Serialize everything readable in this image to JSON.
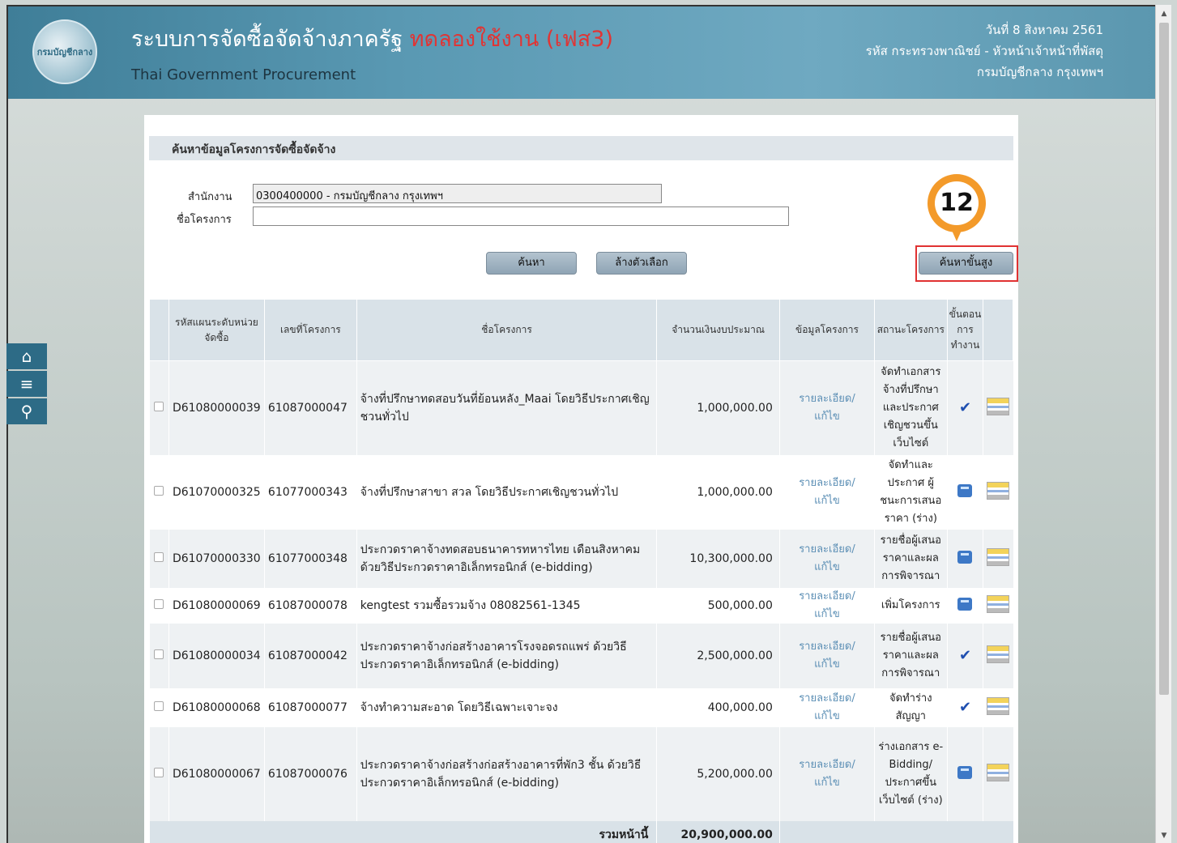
{
  "header": {
    "title": "ระบบการจัดซื้อจัดจ้างภาครัฐ",
    "trial_label": "ทดลองใช้งาน (เฟส3)",
    "subtitle": "Thai Government Procurement",
    "logo_text": "กรมบัญชีกลาง",
    "date": "วันที่ 8 สิงหาคม 2561",
    "user": "รหัส กระทรวงพาณิชย์ - หัวหน้าเจ้าหน้าที่พัสดุ",
    "department": "กรมบัญชีกลาง กรุงเทพฯ"
  },
  "sidebar": {
    "home_icon": "home-icon",
    "menu_icon": "menu-icon",
    "search_icon": "search-icon"
  },
  "search": {
    "section_title": "ค้นหาข้อมูลโครงการจัดซื้อจัดจ้าง",
    "office_label": "สำนักงาน",
    "office_value": "0300400000 - กรมบัญชีกลาง กรุงเทพฯ",
    "project_label": "ชื่อโครงการ",
    "project_value": "",
    "search_button": "ค้นหา",
    "clear_button": "ล้างตัวเลือก",
    "advanced_button": "ค้นหาขั้นสูง",
    "step_badge": "12"
  },
  "table": {
    "headers": {
      "plan_code": "รหัสแผนระดับหน่วยจัดซื้อ",
      "project_no": "เลขที่โครงการ",
      "project_name": "ชื่อโครงการ",
      "budget": "จำนวนเงินงบประมาณ",
      "project_info": "ข้อมูลโครงการ",
      "status": "สถานะโครงการ",
      "step": "ขั้นตอนการทำงาน"
    },
    "rows": [
      {
        "plan": "D61080000039",
        "no": "61087000047",
        "name": "จ้างที่ปรึกษาทดสอบวันที่ย้อนหลัง_Maai โดยวิธีประกาศเชิญชวนทั่วไป",
        "budget": "1,000,000.00",
        "detail": "รายละเอียด/แก้ไข",
        "status": "จัดทำเอกสารจ้างที่ปรึกษาและประกาศเชิญชวนขึ้นเว็บไซต์",
        "icon": "check-icon"
      },
      {
        "plan": "D61070000325",
        "no": "61077000343",
        "name": "จ้างที่ปรึกษาสาขา สวล โดยวิธีประกาศเชิญชวนทั่วไป",
        "budget": "1,000,000.00",
        "detail": "รายละเอียด/แก้ไข",
        "status": "จัดทำและประกาศ ผู้ชนะการเสนอราคา (ร่าง)",
        "icon": "hand-icon"
      },
      {
        "plan": "D61070000330",
        "no": "61077000348",
        "name": "ประกวดราคาจ้างทดสอบธนาคารทหารไทย เดือนสิงหาคม ด้วยวิธีประกวดราคาอิเล็กทรอนิกส์ (e-bidding)",
        "budget": "10,300,000.00",
        "detail": "รายละเอียด/แก้ไข",
        "status": "รายชื่อผู้เสนอราคาและผลการพิจารณา",
        "icon": "hand-icon"
      },
      {
        "plan": "D61080000069",
        "no": "61087000078",
        "name": "kengtest รวมซื้อรวมจ้าง 08082561-1345",
        "budget": "500,000.00",
        "detail": "รายละเอียด/แก้ไข",
        "status": "เพิ่มโครงการ",
        "icon": "hand-icon"
      },
      {
        "plan": "D61080000034",
        "no": "61087000042",
        "name": "ประกวดราคาจ้างก่อสร้างอาคารโรงจอดรถแพร่ ด้วยวิธีประกวดราคาอิเล็กทรอนิกส์ (e-bidding)",
        "budget": "2,500,000.00",
        "detail": "รายละเอียด/แก้ไข",
        "status": "รายชื่อผู้เสนอราคาและผลการพิจารณา",
        "icon": "check-icon"
      },
      {
        "plan": "D61080000068",
        "no": "61087000077",
        "name": "จ้างทำความสะอาด โดยวิธีเฉพาะเจาะจง",
        "budget": "400,000.00",
        "detail": "รายละเอียด/แก้ไข",
        "status": "จัดทำร่างสัญญา",
        "icon": "check-icon"
      },
      {
        "plan": "D61080000067",
        "no": "61087000076",
        "name": "ประกวดราคาจ้างก่อสร้างก่อสร้างอาคารที่พัก3 ชั้น ด้วยวิธีประกวดราคาอิเล็กทรอนิกส์ (e-bidding)",
        "budget": "5,200,000.00",
        "detail": "รายละเอียด/แก้ไข",
        "status": "ร่างเอกสาร e-Bidding/ประกาศขึ้นเว็บไซต์ (ร่าง)",
        "icon": "hand-icon"
      }
    ],
    "total_label": "รวมหน้านี้",
    "total_value": "20,900,000.00"
  }
}
